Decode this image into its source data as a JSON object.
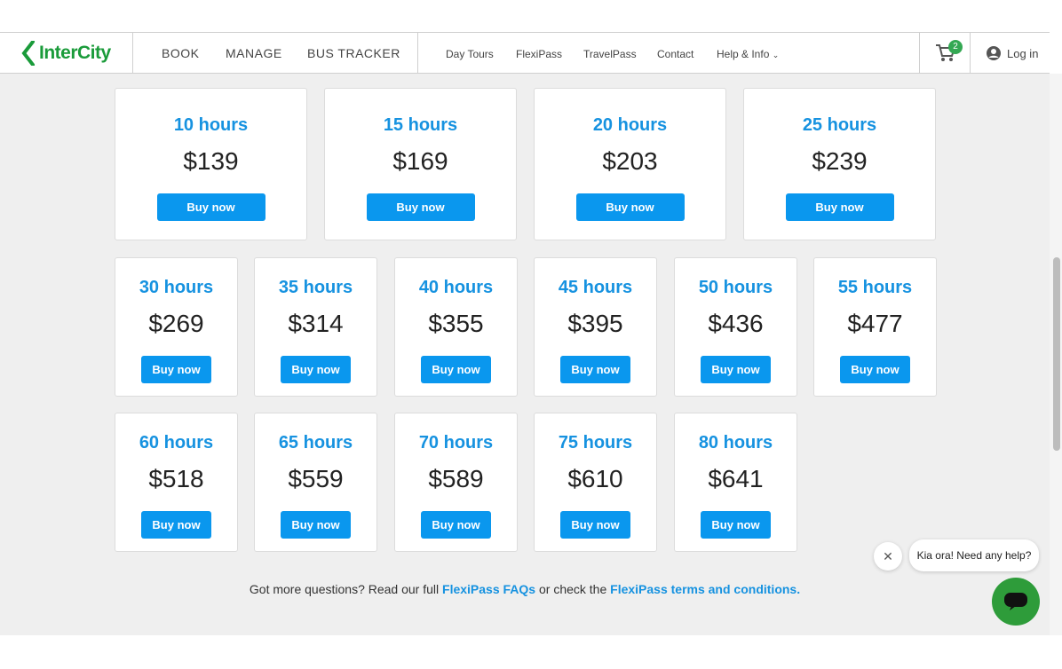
{
  "brand": {
    "name": "InterCity",
    "color": "#1a9b3a"
  },
  "nav": {
    "primary": [
      "BOOK",
      "MANAGE",
      "BUS TRACKER"
    ],
    "secondary": [
      "Day Tours",
      "FlexiPass",
      "TravelPass",
      "Contact",
      "Help & Info"
    ],
    "cart_count": "2",
    "login_label": "Log in"
  },
  "buy_label": "Buy now",
  "passes": [
    {
      "hours": "10 hours",
      "price": "$139"
    },
    {
      "hours": "15 hours",
      "price": "$169"
    },
    {
      "hours": "20 hours",
      "price": "$203"
    },
    {
      "hours": "25 hours",
      "price": "$239"
    },
    {
      "hours": "30 hours",
      "price": "$269"
    },
    {
      "hours": "35 hours",
      "price": "$314"
    },
    {
      "hours": "40 hours",
      "price": "$355"
    },
    {
      "hours": "45 hours",
      "price": "$395"
    },
    {
      "hours": "50 hours",
      "price": "$436"
    },
    {
      "hours": "55 hours",
      "price": "$477"
    },
    {
      "hours": "60 hours",
      "price": "$518"
    },
    {
      "hours": "65 hours",
      "price": "$559"
    },
    {
      "hours": "70 hours",
      "price": "$589"
    },
    {
      "hours": "75 hours",
      "price": "$610"
    },
    {
      "hours": "80 hours",
      "price": "$641"
    }
  ],
  "footer": {
    "prefix": "Got more questions? Read our full ",
    "faq_link": "FlexiPass FAQs",
    "middle": " or check the ",
    "terms_link": "FlexiPass terms and conditions."
  },
  "chat": {
    "message": "Kia ora! Need any help?",
    "close_icon": "close-icon",
    "button_icon": "chat-icon"
  },
  "colors": {
    "accent": "#1692e0",
    "button": "#0a97ee",
    "chat": "#2e9c3a",
    "badge": "#34a853"
  }
}
